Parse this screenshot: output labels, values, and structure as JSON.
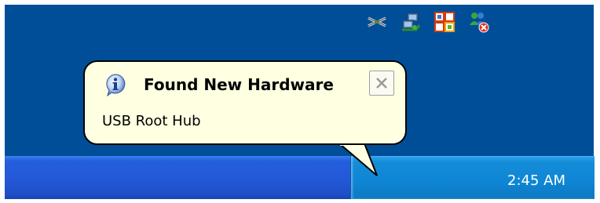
{
  "balloon": {
    "title": "Found New Hardware",
    "message": "USB Root Hub",
    "icon": "info-icon",
    "close_icon": "close-icon"
  },
  "tray": {
    "clock": "2:45 AM",
    "icons": [
      "safely-remove-hardware-icon",
      "network-connection-icon",
      "office-clipboard-icon",
      "messenger-offline-icon"
    ]
  },
  "colors": {
    "desktop": "#004e98",
    "taskbar": "#245edb",
    "tray": "#138cd8",
    "balloon_background": "#ffffe1"
  }
}
